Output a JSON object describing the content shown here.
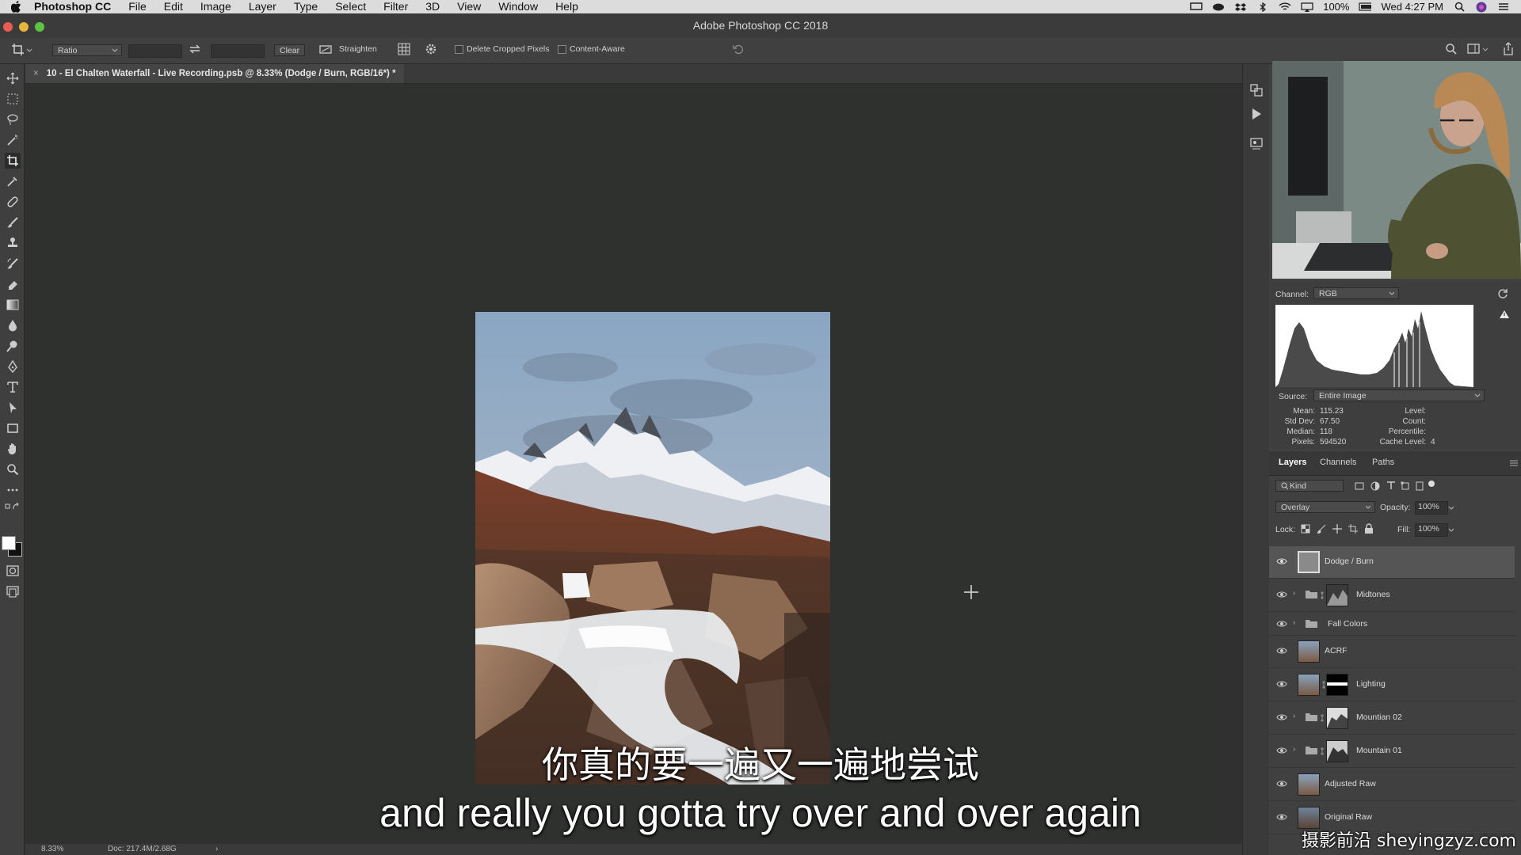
{
  "menubar": {
    "app_name": "Photoshop CC",
    "items": [
      "File",
      "Edit",
      "Image",
      "Layer",
      "Type",
      "Select",
      "Filter",
      "3D",
      "View",
      "Window",
      "Help"
    ],
    "battery": "100%",
    "clock": "Wed 4:27 PM"
  },
  "window": {
    "title": "Adobe Photoshop CC 2018"
  },
  "options_bar": {
    "ratio_label": "Ratio",
    "width_value": "",
    "height_value": "",
    "clear_label": "Clear",
    "straighten_label": "Straighten",
    "delete_cropped_label": "Delete Cropped Pixels",
    "content_aware_label": "Content-Aware"
  },
  "document": {
    "tab_title": "10 - El Chalten Waterfall - Live Recording.psb @ 8.33% (Dodge / Burn, RGB/16*) *",
    "close_glyph": "×"
  },
  "statusbar": {
    "zoom": "8.33%",
    "doc_size": "Doc: 217.4M/2.68G",
    "arrow": "›"
  },
  "histogram": {
    "channel_label": "Channel:",
    "channel_value": "RGB",
    "source_label": "Source:",
    "source_value": "Entire Image",
    "stats": {
      "mean_label": "Mean:",
      "mean": "115.23",
      "stddev_label": "Std Dev:",
      "stddev": "67.50",
      "median_label": "Median:",
      "median": "118",
      "pixels_label": "Pixels:",
      "pixels": "594520",
      "level_label": "Level:",
      "count_label": "Count:",
      "percentile_label": "Percentile:",
      "cache_label": "Cache Level:",
      "cache": "4"
    }
  },
  "layers_panel": {
    "tabs": [
      "Layers",
      "Channels",
      "Paths"
    ],
    "kind_label": "Kind",
    "blend_mode": "Overlay",
    "opacity_label": "Opacity:",
    "opacity": "100%",
    "lock_label": "Lock:",
    "fill_label": "Fill:",
    "fill": "100%",
    "layers": [
      {
        "name": "Dodge / Burn"
      },
      {
        "name": "Midtones"
      },
      {
        "name": "Fall Colors"
      },
      {
        "name": "ACRF"
      },
      {
        "name": "Lighting"
      },
      {
        "name": "Mountian 02"
      },
      {
        "name": "Mountain 01"
      },
      {
        "name": "Adjusted Raw"
      },
      {
        "name": "Original Raw"
      }
    ]
  },
  "subtitles": {
    "chinese": "你真的要一遍又一遍地尝试",
    "english": "and really you gotta try over and over again"
  },
  "watermark": "摄影前沿 sheyingzyz.com",
  "colors": {
    "canvas_bg": "#2f312f",
    "panel_bg": "#414141",
    "selected_layer": "#555555"
  }
}
